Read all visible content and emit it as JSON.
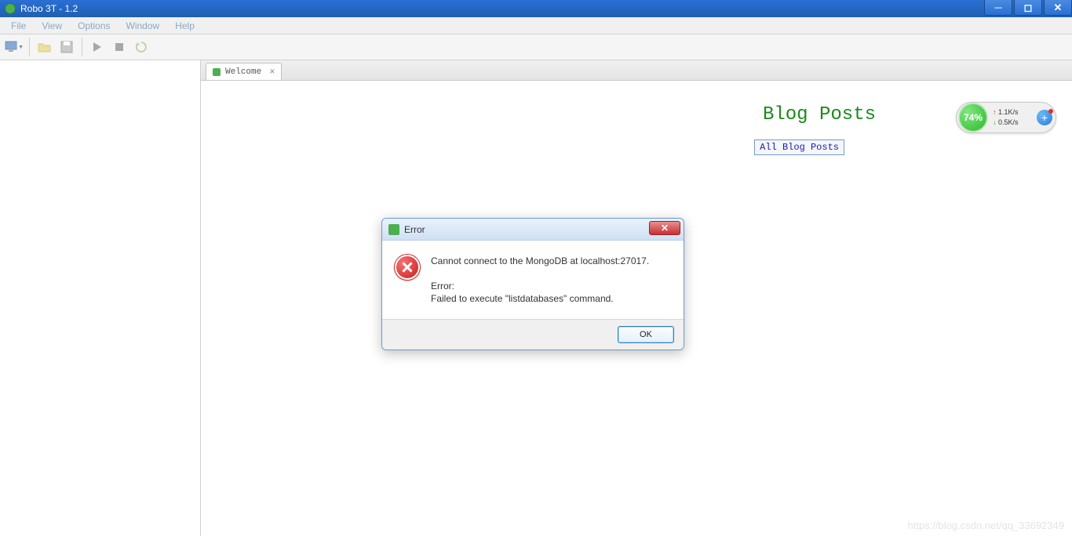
{
  "window": {
    "title": "Robo 3T - 1.2"
  },
  "menus": {
    "file": "File",
    "view": "View",
    "options": "Options",
    "window": "Window",
    "help": "Help"
  },
  "tab": {
    "label": "Welcome"
  },
  "blog": {
    "heading": "Blog Posts",
    "all_link": "All Blog Posts"
  },
  "net": {
    "percent": "74%",
    "up": "1.1K/s",
    "down": "0.5K/s"
  },
  "dialog": {
    "title": "Error",
    "line1": "Cannot connect to the MongoDB at localhost:27017.",
    "line2": "Error:",
    "line3": "Failed to execute \"listdatabases\" command.",
    "ok": "OK"
  },
  "watermark": "https://blog.csdn.net/qq_33692349"
}
